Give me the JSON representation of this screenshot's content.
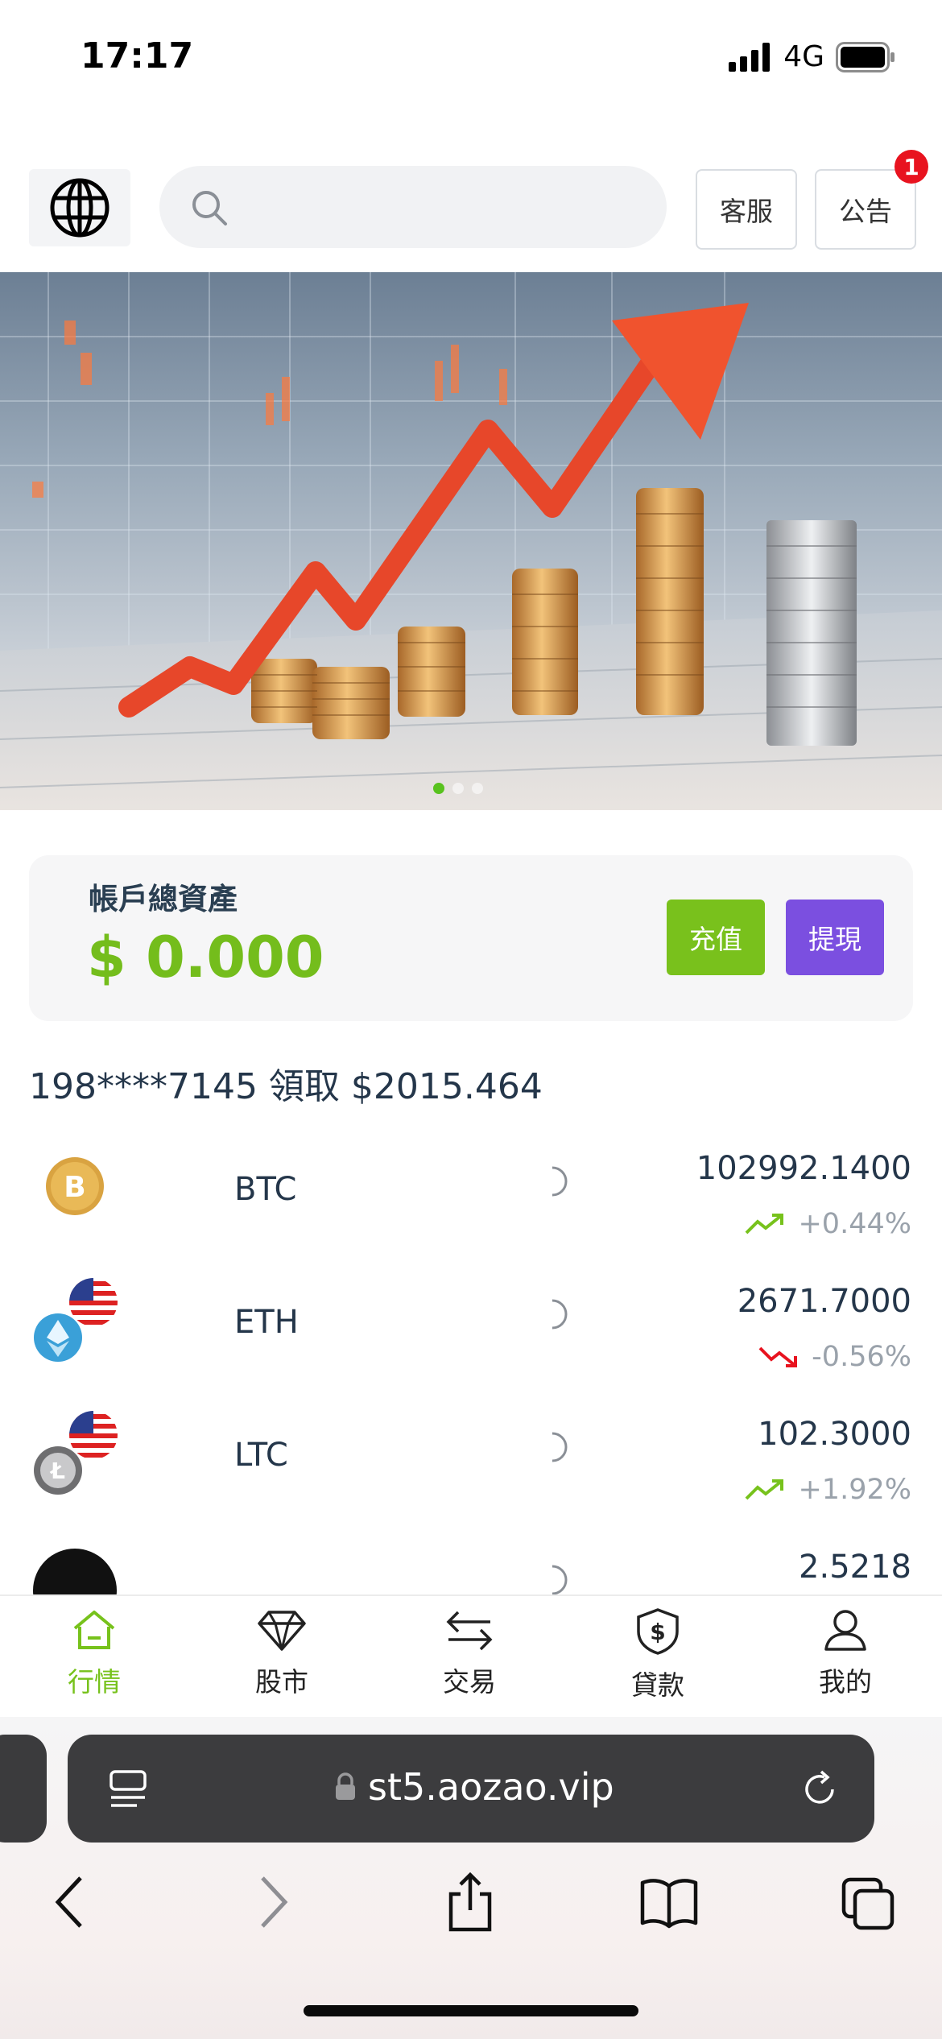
{
  "status_bar": {
    "time": "17:17",
    "network": "4G"
  },
  "header": {
    "service_label": "客服",
    "notice_label": "公告",
    "notice_badge": "1",
    "search_placeholder": ""
  },
  "banner": {
    "active_slide": 1,
    "slide_count": 3
  },
  "assets": {
    "label": "帳戶總資產",
    "value": "$ 0.000",
    "deposit_label": "充值",
    "withdraw_label": "提現"
  },
  "ticker": {
    "text": "198****7145 領取 $2015.464"
  },
  "market": {
    "rows": [
      {
        "symbol": "BTC",
        "price": "102992.1400",
        "change": "+0.44%",
        "trend": "up"
      },
      {
        "symbol": "ETH",
        "price": "2671.7000",
        "change": "-0.56%",
        "trend": "down"
      },
      {
        "symbol": "LTC",
        "price": "102.3000",
        "change": "+1.92%",
        "trend": "up"
      },
      {
        "symbol": "",
        "price": "2.5218",
        "change": "",
        "trend": ""
      }
    ]
  },
  "tabbar": {
    "items": [
      {
        "label": "行情",
        "active": true
      },
      {
        "label": "股市",
        "active": false
      },
      {
        "label": "交易",
        "active": false
      },
      {
        "label": "貸款",
        "active": false
      },
      {
        "label": "我的",
        "active": false
      }
    ]
  },
  "browser": {
    "url": "st5.aozao.vip"
  },
  "colors": {
    "accent_green": "#77c21c",
    "accent_purple": "#7b4fe0",
    "up": "#77c21c",
    "down": "#e8131f",
    "badge": "#e8131f"
  }
}
